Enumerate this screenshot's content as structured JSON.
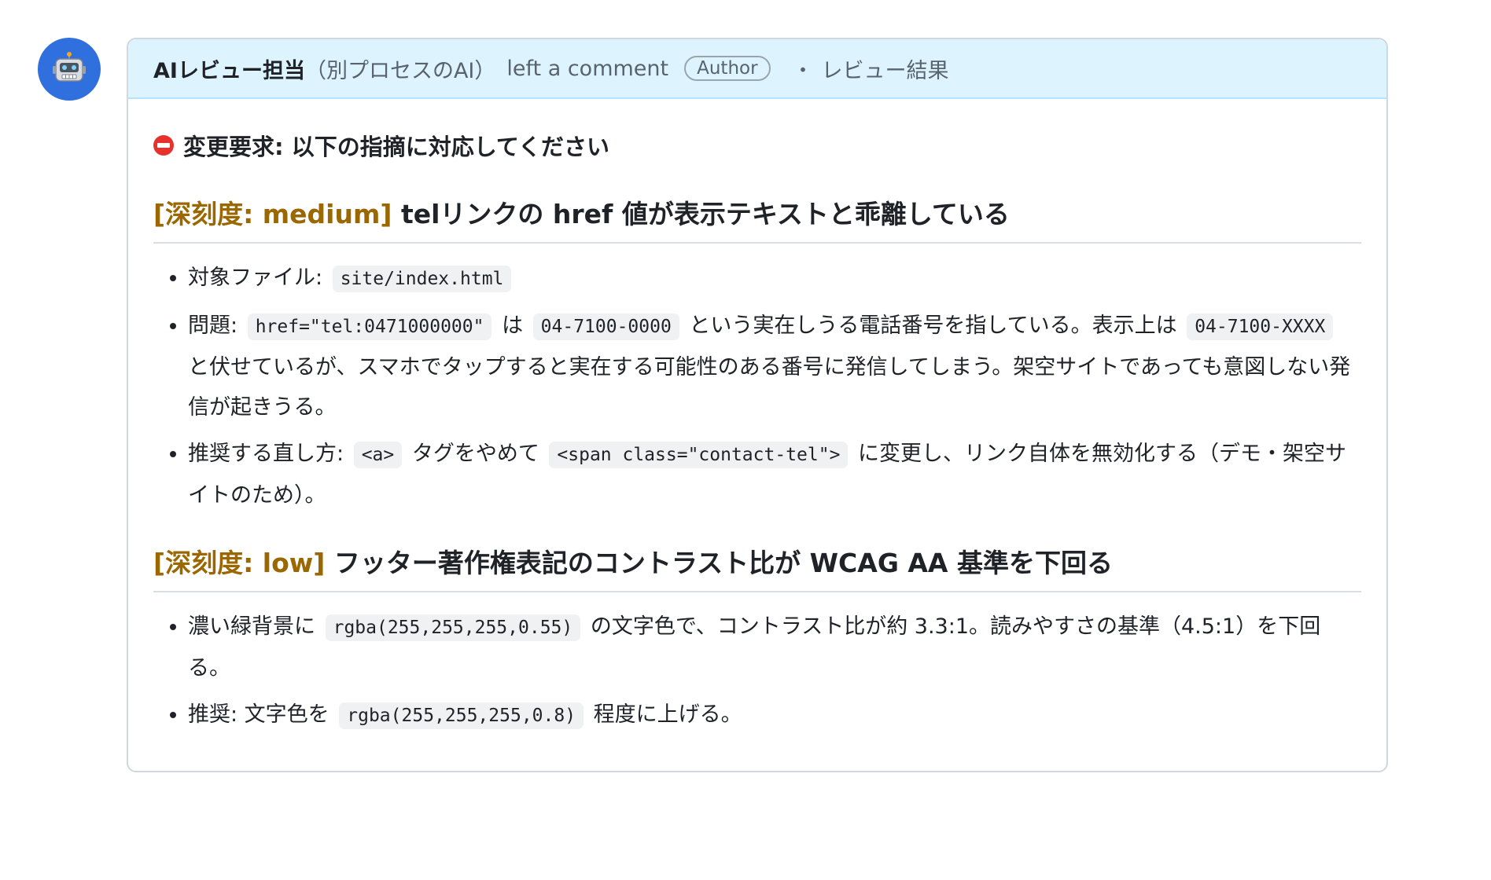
{
  "comment": {
    "author": "AIレビュー担当",
    "author_note": "（別プロセスのAI）",
    "action": "left a comment",
    "badge": "Author",
    "separator": "・",
    "label": "レビュー結果"
  },
  "body": {
    "verdict": "変更要求: 以下の指摘に対応してください",
    "findings": [
      {
        "severity": "[深刻度: medium]",
        "title": "telリンクの href 値が表示テキストと乖離している",
        "items": [
          {
            "segments": [
              {
                "t": "text",
                "v": "対象ファイル: "
              },
              {
                "t": "code",
                "v": "site/index.html"
              }
            ]
          },
          {
            "segments": [
              {
                "t": "text",
                "v": "問題: "
              },
              {
                "t": "code",
                "v": "href=\"tel:0471000000\""
              },
              {
                "t": "text",
                "v": " は "
              },
              {
                "t": "code",
                "v": "04-7100-0000"
              },
              {
                "t": "text",
                "v": " という実在しうる電話番号を指している。表示上は "
              },
              {
                "t": "code",
                "v": "04-7100-XXXX"
              },
              {
                "t": "text",
                "v": " と伏せているが、スマホでタップすると実在する可能性のある番号に発信してしまう。架空サイトであっても意図しない発信が起きうる。"
              }
            ]
          },
          {
            "segments": [
              {
                "t": "text",
                "v": "推奨する直し方: "
              },
              {
                "t": "code",
                "v": "<a>"
              },
              {
                "t": "text",
                "v": " タグをやめて "
              },
              {
                "t": "code",
                "v": "<span class=\"contact-tel\">"
              },
              {
                "t": "text",
                "v": " に変更し、リンク自体を無効化する（デモ・架空サイトのため）。"
              }
            ]
          }
        ]
      },
      {
        "severity": "[深刻度: low]",
        "title": "フッター著作権表記のコントラスト比が WCAG AA 基準を下回る",
        "items": [
          {
            "segments": [
              {
                "t": "text",
                "v": "濃い緑背景に "
              },
              {
                "t": "code",
                "v": "rgba(255,255,255,0.55)"
              },
              {
                "t": "text",
                "v": " の文字色で、コントラスト比が約 3.3:1。読みやすさの基準（4.5:1）を下回る。"
              }
            ]
          },
          {
            "segments": [
              {
                "t": "text",
                "v": "推奨: 文字色を "
              },
              {
                "t": "code",
                "v": "rgba(255,255,255,0.8)"
              },
              {
                "t": "text",
                "v": " 程度に上げる。"
              }
            ]
          }
        ]
      }
    ]
  },
  "icons": {
    "avatar": "robot-icon",
    "verdict": "no-entry-icon"
  },
  "colors": {
    "avatar_bg": "#2f6fde",
    "header_bg": "#ddf4ff",
    "severity": "#9a6700",
    "stop": "#e5322d"
  }
}
